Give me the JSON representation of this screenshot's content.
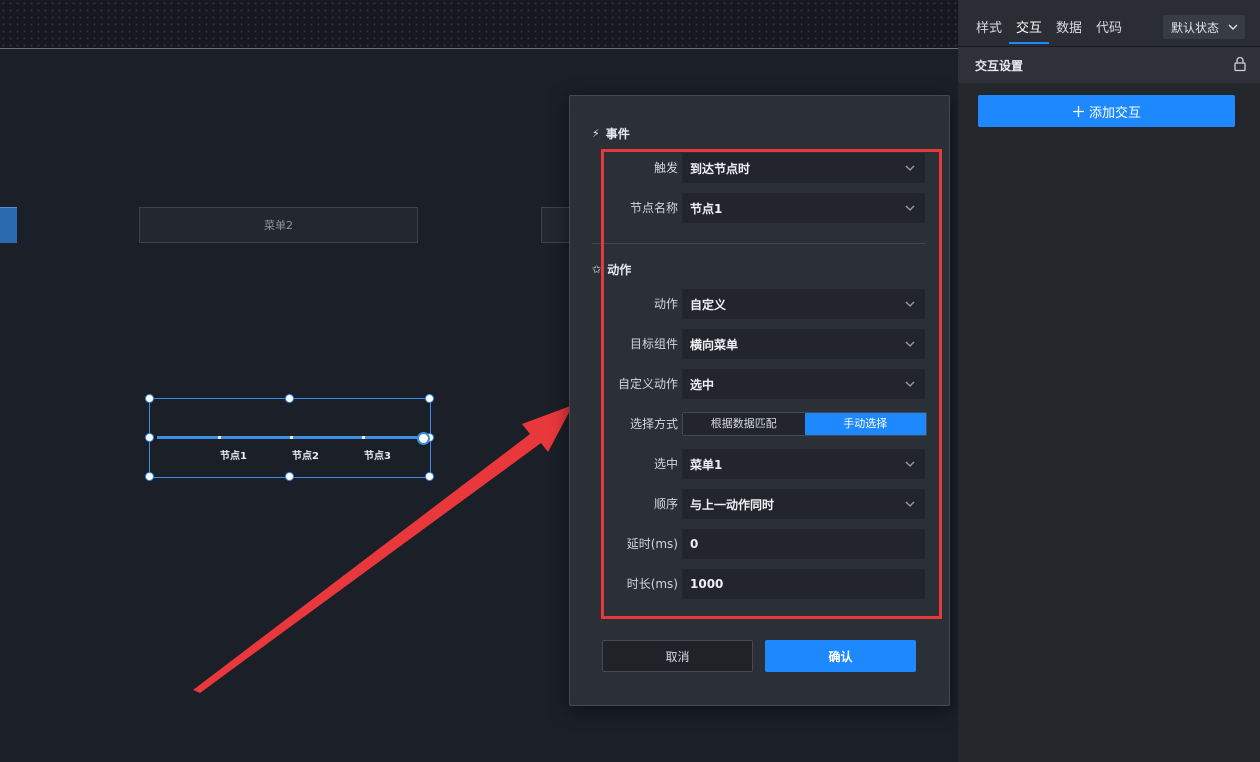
{
  "canvas": {
    "menu2_label": "菜单2",
    "nodes": [
      "节点1",
      "节点2",
      "节点3"
    ]
  },
  "dialog": {
    "event_title": "事件",
    "action_title": "动作",
    "fields": {
      "trigger": {
        "label": "触发",
        "value": "到达节点时"
      },
      "node_name": {
        "label": "节点名称",
        "value": "节点1"
      },
      "action": {
        "label": "动作",
        "value": "自定义"
      },
      "target": {
        "label": "目标组件",
        "value": "横向菜单"
      },
      "custom_action": {
        "label": "自定义动作",
        "value": "选中"
      },
      "select_mode": {
        "label": "选择方式",
        "options": [
          "根据数据匹配",
          "手动选择"
        ],
        "selected": "手动选择"
      },
      "selected": {
        "label": "选中",
        "value": "菜单1"
      },
      "order": {
        "label": "顺序",
        "value": "与上一动作同时"
      },
      "delay": {
        "label": "延时(ms)",
        "value": "0"
      },
      "duration": {
        "label": "时长(ms)",
        "value": "1000"
      }
    },
    "cancel_label": "取消",
    "confirm_label": "确认"
  },
  "panel": {
    "tabs": [
      "样式",
      "交互",
      "数据",
      "代码"
    ],
    "active_tab": "交互",
    "state_dropdown": "默认状态",
    "section_title": "交互设置",
    "add_button": "添加交互"
  },
  "colors": {
    "accent": "#1e88ff",
    "highlight_box": "#e6393b",
    "arrow": "#e8383c"
  },
  "icons": {
    "event": "lightning-icon",
    "action": "star-icon",
    "dropdown": "chevron-down-icon",
    "lock": "lock-icon",
    "add": "plus-icon"
  }
}
